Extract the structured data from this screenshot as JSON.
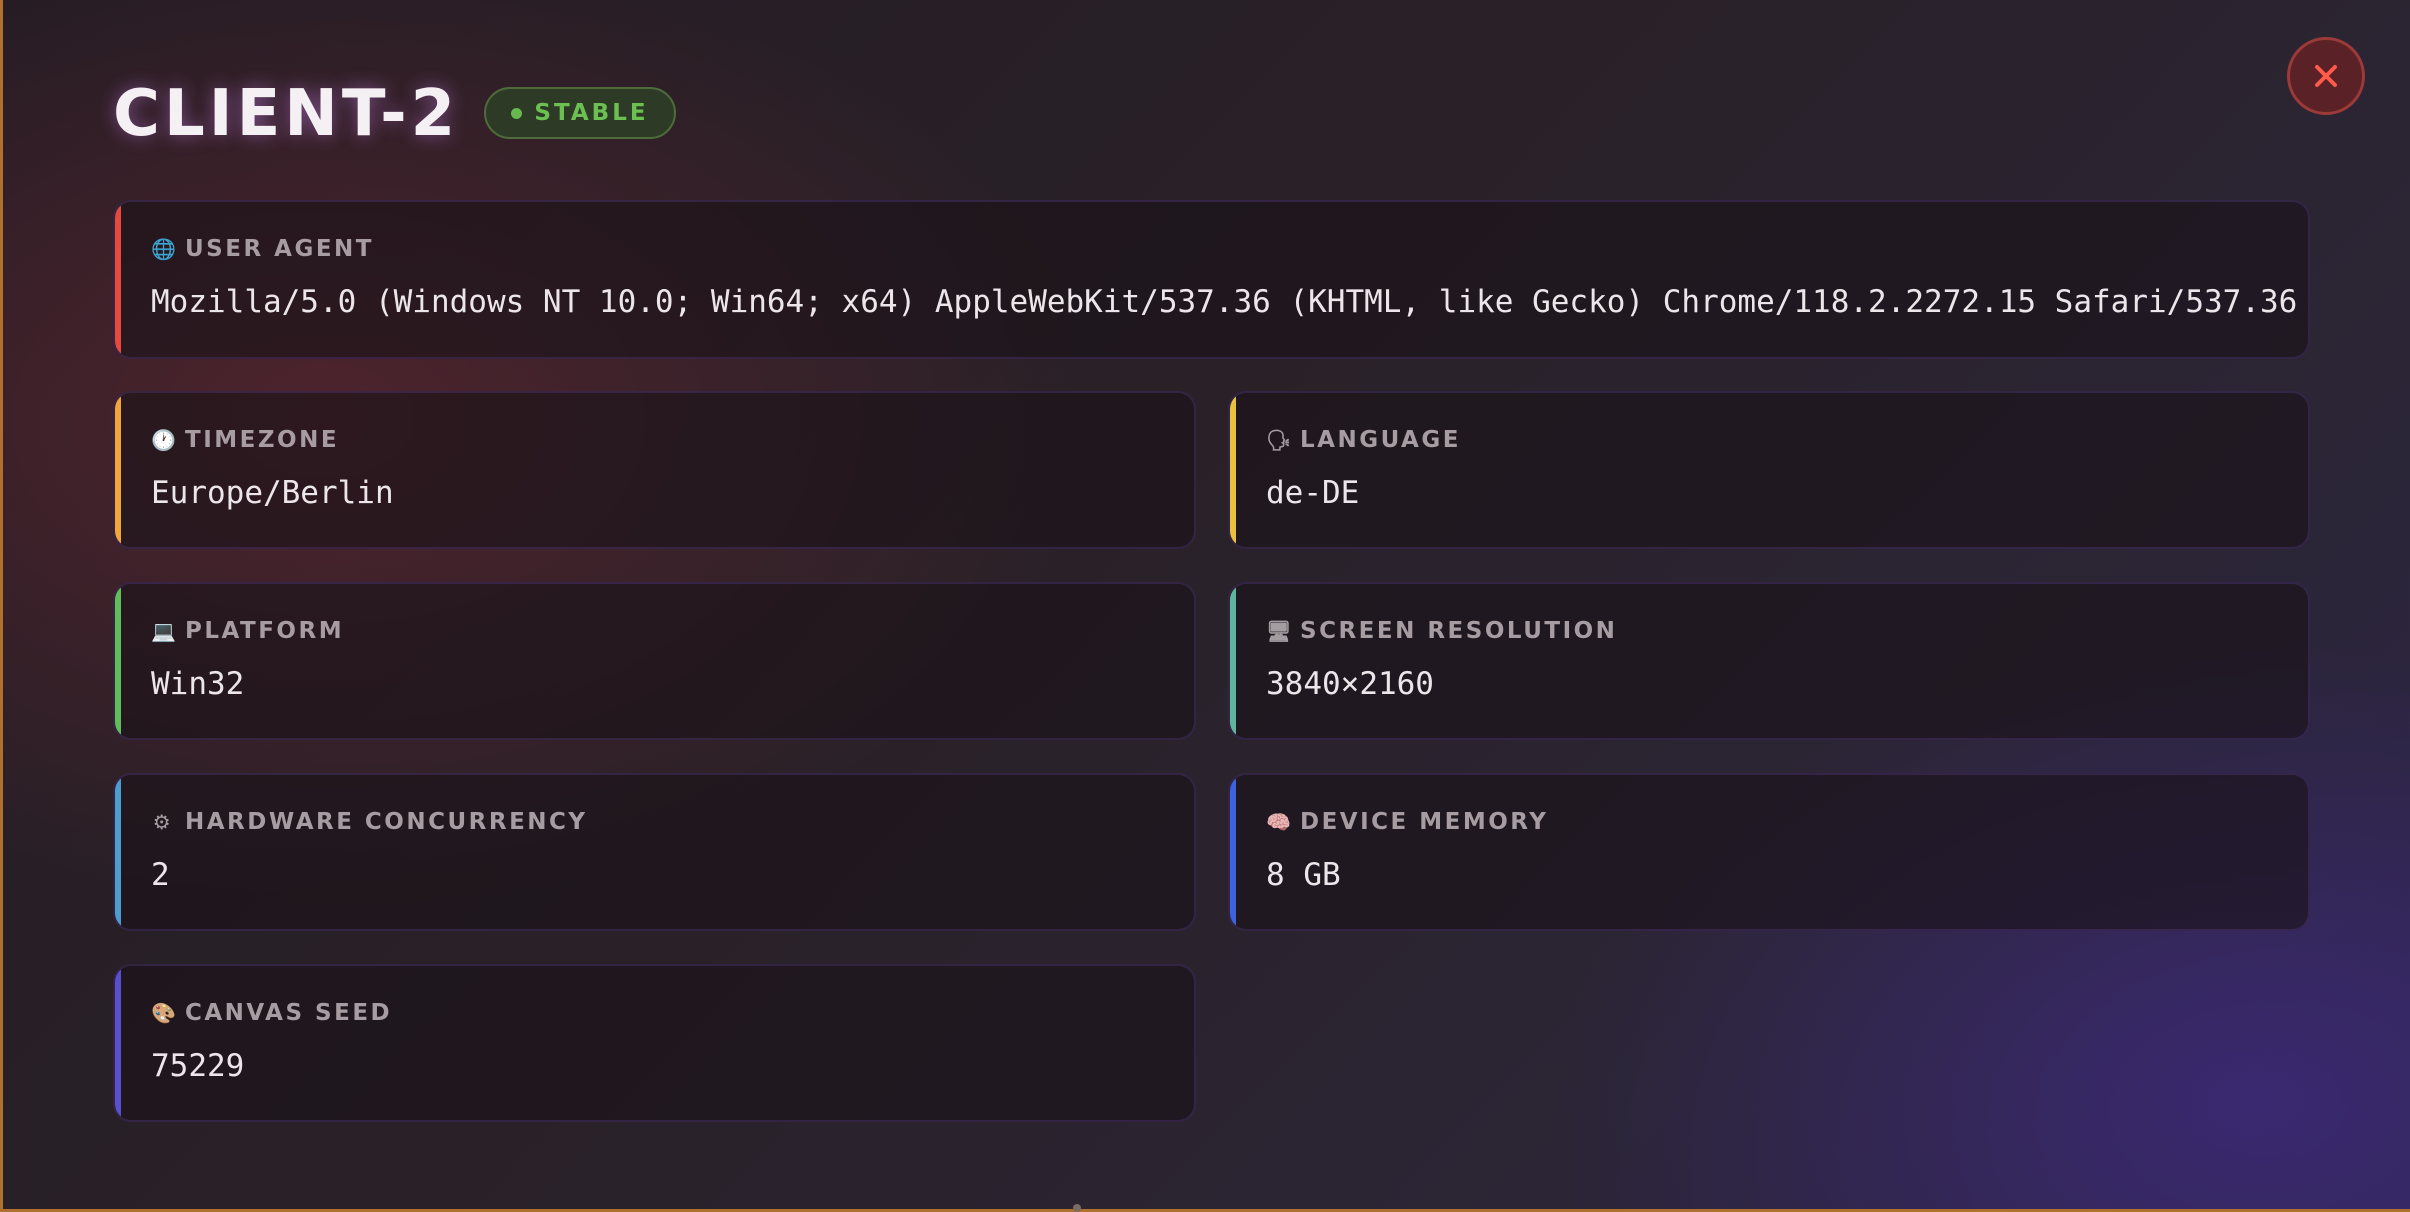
{
  "header": {
    "title": "CLIENT-2",
    "status": "STABLE"
  },
  "close": {
    "icon": "close-icon"
  },
  "fields": [
    {
      "key": "user-agent",
      "icon": "globe-icon",
      "glyph": "🌐",
      "label": "USER AGENT",
      "value": "Mozilla/5.0 (Windows NT 10.0; Win64; x64) AppleWebKit/537.36 (KHTML, like Gecko) Chrome/118.2.2272.15 Safari/537.36",
      "accent": "#e54a3c"
    },
    {
      "key": "timezone",
      "icon": "clock-icon",
      "glyph": "🕐",
      "label": "TIMEZONE",
      "value": "Europe/Berlin",
      "accent": "#f0a63a"
    },
    {
      "key": "language",
      "icon": "speech-icon",
      "glyph": "🗣",
      "label": "LANGUAGE",
      "value": "de-DE",
      "accent": "#e8c23e"
    },
    {
      "key": "platform",
      "icon": "laptop-icon",
      "glyph": "💻",
      "label": "PLATFORM",
      "value": "Win32",
      "accent": "#5fbd5a"
    },
    {
      "key": "screen-resolution",
      "icon": "monitor-icon",
      "glyph": "🖥",
      "label": "SCREEN RESOLUTION",
      "value": "3840×2160",
      "accent": "#5fb59e"
    },
    {
      "key": "hardware-concurrency",
      "icon": "gear-icon",
      "glyph": "⚙",
      "label": "HARDWARE CONCURRENCY",
      "value": "2",
      "accent": "#4d9ed0"
    },
    {
      "key": "device-memory",
      "icon": "brain-icon",
      "glyph": "🧠",
      "label": "DEVICE MEMORY",
      "value": "8 GB",
      "accent": "#3d63e0"
    },
    {
      "key": "canvas-seed",
      "icon": "palette-icon",
      "glyph": "🎨",
      "label": "CANVAS SEED",
      "value": "75229",
      "accent": "#5a4fcf"
    }
  ]
}
